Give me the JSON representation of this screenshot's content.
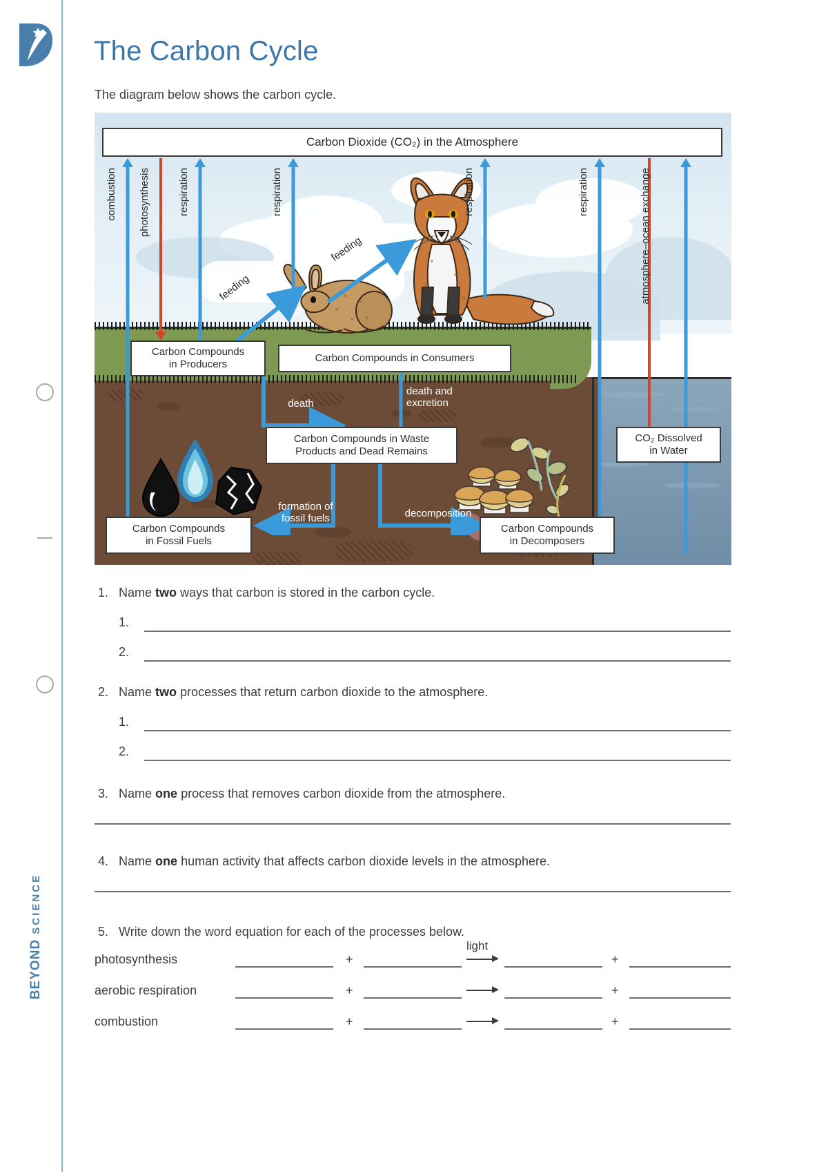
{
  "brand": {
    "logo_letter": "B",
    "footer_bold": "BEYOND",
    "footer_light": "SCIENCE"
  },
  "header": {
    "title": "The Carbon Cycle",
    "intro": "The diagram below shows the carbon cycle."
  },
  "diagram": {
    "atmosphere_box": "Carbon Dioxide (CO₂) in the Atmosphere",
    "boxes": {
      "producers": "Carbon Compounds in Producers",
      "producers_l1": "Carbon Compounds",
      "producers_l2": "in Producers",
      "consumers": "Carbon Compounds in Consumers",
      "waste_l1": "Carbon Compounds in Waste",
      "waste_l2": "Products and Dead Remains",
      "fossil_l1": "Carbon Compounds",
      "fossil_l2": "in Fossil Fuels",
      "decomposers_l1": "Carbon Compounds",
      "decomposers_l2": "in Decomposers",
      "co2_water_l1": "CO₂ Dissolved",
      "co2_water_l2": "in Water"
    },
    "arrow_labels": {
      "combustion": "combustion",
      "photosynthesis": "photosynthesis",
      "respiration_producers": "respiration",
      "respiration_rabbit": "respiration",
      "respiration_fox": "respiration",
      "respiration_ocean": "respiration",
      "atmosphere_ocean": "atmosphere–ocean exchange",
      "feeding_1": "feeding",
      "feeding_2": "feeding",
      "death": "death",
      "death_excretion_l1": "death and",
      "death_excretion_l2": "excretion",
      "formation_l1": "formation of",
      "formation_l2": "fossil fuels",
      "decomposition": "decomposition"
    },
    "colors": {
      "blue_arrow": "#3b9ad9",
      "red_arrow": "#d1472a",
      "grass": "#7e9a52",
      "soil": "#6d4c37",
      "ocean": "#7e9bb2",
      "sky": "#d3e4ef"
    }
  },
  "questions": [
    {
      "number": "1.",
      "text_before": "Name ",
      "bold": "two",
      "text_after": " ways that carbon is stored in the carbon cycle.",
      "sub": [
        "1.",
        "2."
      ]
    },
    {
      "number": "2.",
      "text_before": "Name ",
      "bold": "two",
      "text_after": " processes that return carbon dioxide to the atmosphere.",
      "sub": [
        "1.",
        "2."
      ]
    },
    {
      "number": "3.",
      "text_before": "Name ",
      "bold": "one",
      "text_after": " process that removes carbon dioxide from the atmosphere.",
      "sub": []
    },
    {
      "number": "4.",
      "text_before": "Name ",
      "bold": "one",
      "text_after": " human activity that affects carbon dioxide levels in the atmosphere.",
      "sub": []
    },
    {
      "number": "5.",
      "text_before": "Write down the word equation for each of the processes below.",
      "bold": "",
      "text_after": "",
      "sub": []
    }
  ],
  "equations": {
    "plus": "+",
    "light_label": "light",
    "rows": [
      {
        "name": "photosynthesis",
        "has_light": true
      },
      {
        "name": "aerobic respiration",
        "has_light": false
      },
      {
        "name": "combustion",
        "has_light": false
      }
    ]
  }
}
